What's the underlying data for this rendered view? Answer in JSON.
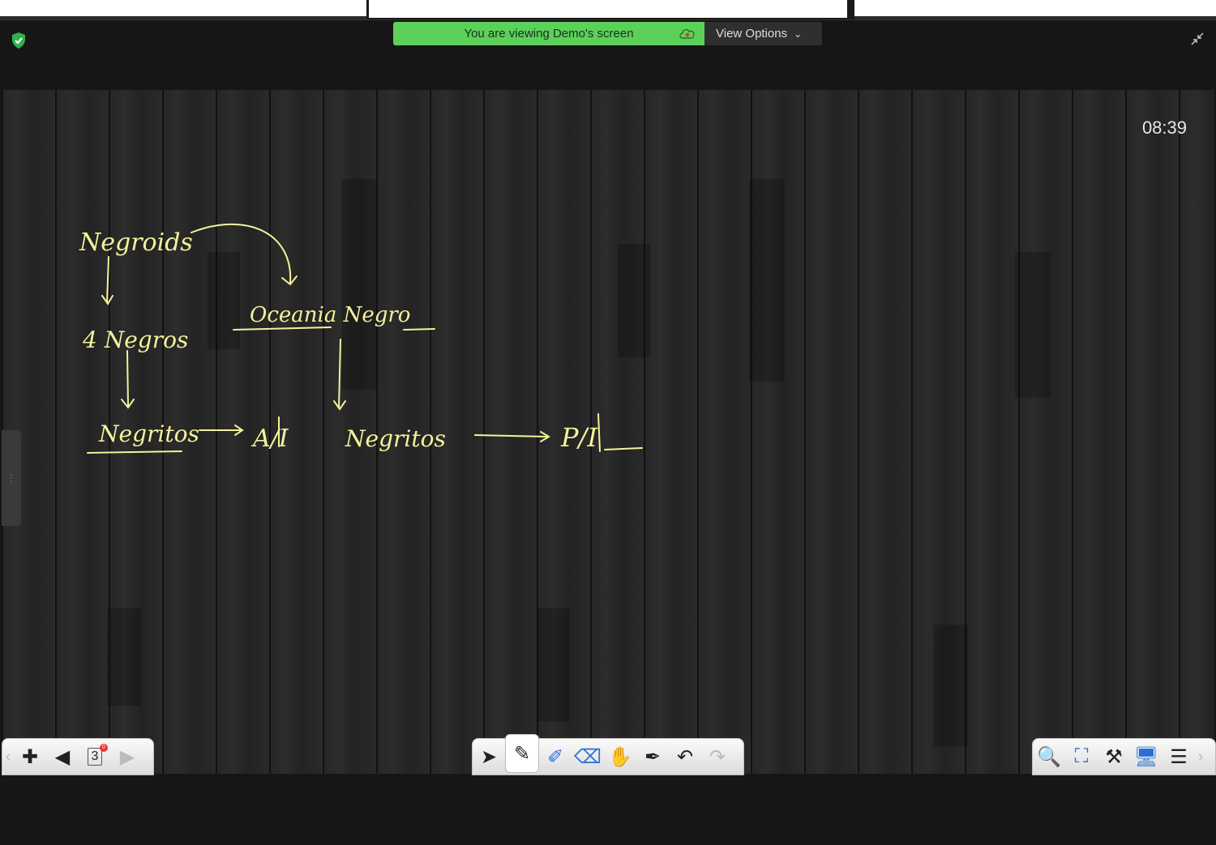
{
  "banner": {
    "text": "You are viewing Demo's screen"
  },
  "view_options": {
    "label": "View Options",
    "icon": "chevron-down-icon"
  },
  "timer": "08:39",
  "whiteboard": {
    "ink_color": "#f4f29a",
    "handwriting": [
      "Negroids",
      "4 Negros",
      "Oceania Negro",
      "Negritos",
      "A/I",
      "Negritos",
      "P/I"
    ]
  },
  "toolbars": {
    "left": {
      "page_number": "3",
      "badge": "0"
    }
  },
  "colors": {
    "banner_green": "#5dd05a",
    "board_dark": "#262626",
    "toolbar_bg": "#ececec"
  }
}
